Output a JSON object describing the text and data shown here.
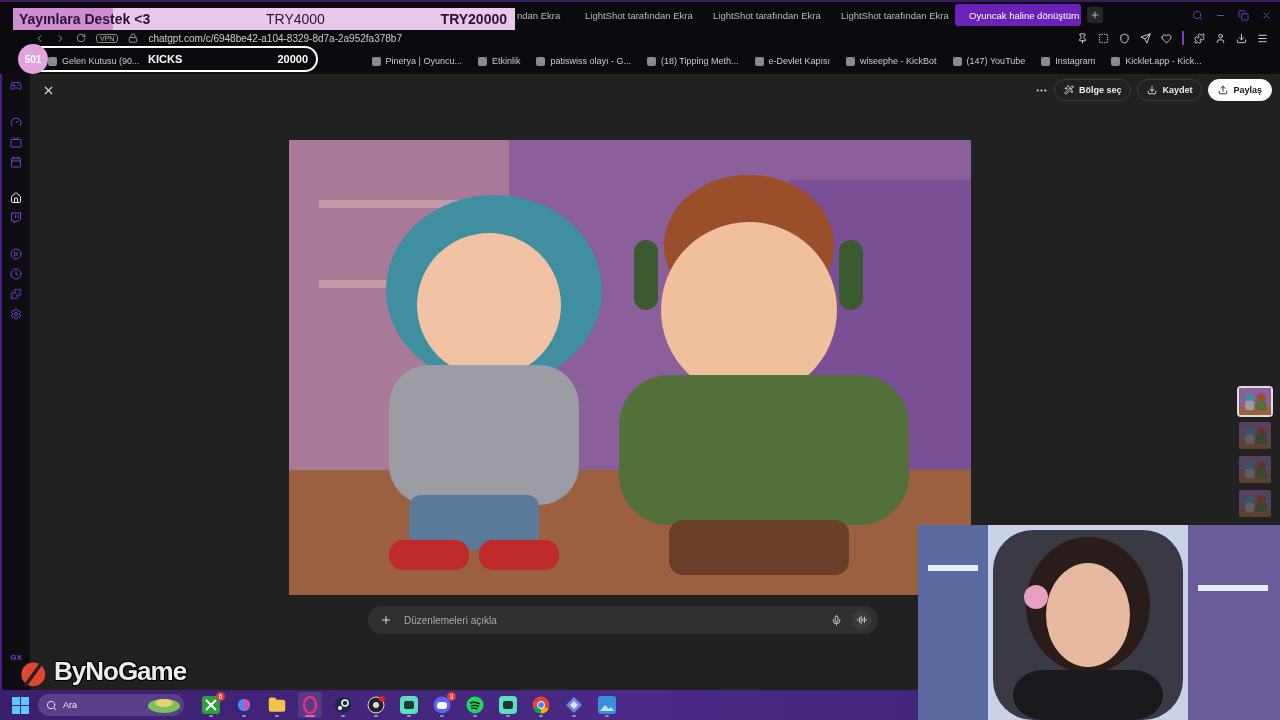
{
  "donation_overlay": {
    "title": "Yayınlara Destek",
    "emote": "<3",
    "current": "TRY4000",
    "target": "TRY20000",
    "level": 0.2
  },
  "kicks_overlay": {
    "count": "501",
    "label": "KICKS",
    "goal": "20000"
  },
  "tabs": [
    {
      "label": "ndan Ekra",
      "selected": false
    },
    {
      "label": "LightShot tarafından Ekra",
      "selected": false
    },
    {
      "label": "LightShot tarafından Ekra",
      "selected": false
    },
    {
      "label": "LightShot tarafından Ekra",
      "selected": false
    },
    {
      "label": "Oyuncak haline dönüştürn",
      "selected": true
    }
  ],
  "address_bar": {
    "vpn": "VPN",
    "url": "chatgpt.com/c/6948be42-a104-8329-8d7a-2a952fa378b7"
  },
  "bookmarks": [
    {
      "label": "Gelen Kutusu (90..."
    },
    {
      "label": "Pinerya | Oyuncu..."
    },
    {
      "label": "Etkinlik"
    },
    {
      "label": "patiswiss olayı - G..."
    },
    {
      "label": "(18) Tipping Meth..."
    },
    {
      "label": "e-Devlet Kapısı"
    },
    {
      "label": "wiseephe - KickBot"
    },
    {
      "label": "(147) YouTube"
    },
    {
      "label": "Instagram"
    },
    {
      "label": "Kicklet.app - Kick..."
    }
  ],
  "sidebar": {
    "label": "GX"
  },
  "viewer": {
    "actions": [
      {
        "kind": "select",
        "label": "Bölge seç"
      },
      {
        "kind": "save",
        "label": "Kaydet"
      },
      {
        "kind": "share",
        "label": "Paylaş"
      }
    ],
    "thumbnails": [
      {
        "selected": true
      },
      {
        "selected": false
      },
      {
        "selected": false
      },
      {
        "selected": false
      }
    ]
  },
  "composer": {
    "placeholder": "Düzenlemeleri açıkla"
  },
  "logo": {
    "text": "ByNoGame"
  },
  "taskbar": {
    "search_placeholder": "Ara",
    "apps": [
      {
        "kind": "xbox",
        "badge": "6",
        "active": false
      },
      {
        "kind": "copilot",
        "active": false
      },
      {
        "kind": "folder",
        "active": false
      },
      {
        "kind": "opera",
        "active": true
      },
      {
        "kind": "steam",
        "active": false
      },
      {
        "kind": "obs",
        "active": false
      },
      {
        "kind": "chat",
        "active": false
      },
      {
        "kind": "discord",
        "badge": "3",
        "active": false
      },
      {
        "kind": "spotify",
        "active": false
      },
      {
        "kind": "chat",
        "active": false
      },
      {
        "kind": "chrome",
        "active": false
      },
      {
        "kind": "tool",
        "active": false
      },
      {
        "kind": "photos",
        "active": false
      }
    ]
  }
}
